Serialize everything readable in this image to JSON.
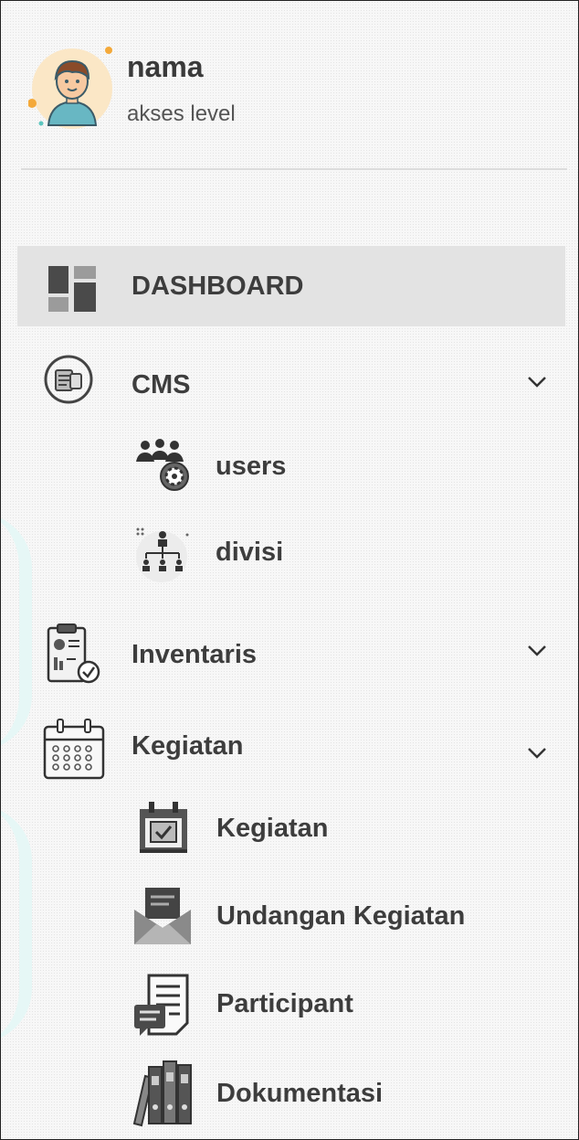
{
  "profile": {
    "name": "nama",
    "level": "akses level"
  },
  "menu": {
    "dashboard": {
      "label": "DASHBOARD",
      "icon": "dashboard-grid-icon"
    },
    "cms": {
      "label": "CMS",
      "icon": "cms-document-icon",
      "children": [
        {
          "label": "users",
          "icon": "users-gear-icon"
        },
        {
          "label": "divisi",
          "icon": "org-chart-icon"
        }
      ]
    },
    "inventaris": {
      "label": "Inventaris",
      "icon": "clipboard-check-icon"
    },
    "kegiatan": {
      "label": "Kegiatan",
      "icon": "calendar-icon",
      "children": [
        {
          "label": "Kegiatan",
          "icon": "calendar-check-icon"
        },
        {
          "label": "Undangan Kegiatan",
          "icon": "envelope-letter-icon"
        },
        {
          "label": "Participant",
          "icon": "document-list-icon"
        },
        {
          "label": "Dokumentasi",
          "icon": "binders-icon"
        }
      ]
    }
  },
  "colors": {
    "active_bg": "#e3e3e3",
    "text": "#3d3d3d",
    "accent": "#f4a93a"
  }
}
